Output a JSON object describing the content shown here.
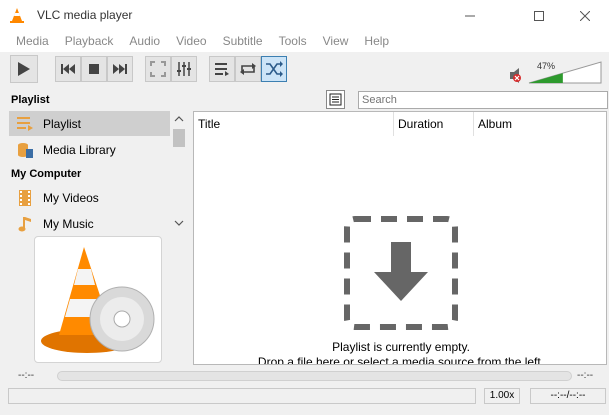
{
  "window": {
    "title": "VLC media player"
  },
  "menu": [
    "Media",
    "Playback",
    "Audio",
    "Video",
    "Subtitle",
    "Tools",
    "View",
    "Help"
  ],
  "toolbar": {
    "buttons": [
      {
        "name": "play-icon"
      },
      {
        "name": "previous-icon"
      },
      {
        "name": "stop-icon"
      },
      {
        "name": "next-icon"
      },
      {
        "name": "fullscreen-icon"
      },
      {
        "name": "extended-settings-icon"
      },
      {
        "name": "playlist-toggle-icon"
      },
      {
        "name": "loop-icon"
      },
      {
        "name": "random-icon"
      }
    ],
    "volume_percent": "47%",
    "volume_level": 0.47
  },
  "sidebar": {
    "playlist_header": "Playlist",
    "playlist_items": [
      "Playlist",
      "Media Library"
    ],
    "computer_header": "My Computer",
    "computer_items": [
      "My Videos",
      "My Music"
    ]
  },
  "search": {
    "placeholder": "Search"
  },
  "playlist": {
    "columns": [
      "Title",
      "Duration",
      "Album"
    ],
    "empty_line1": "Playlist is currently empty.",
    "empty_line2": "Drop a file here or select a media source from the left."
  },
  "seek": {
    "elapsed": "--:--",
    "remaining": "--:--"
  },
  "status": {
    "speed": "1.00x",
    "time": "--:--/--:--"
  },
  "colors": {
    "accent": "#ff8800",
    "active_button": "#cce4f7",
    "volume_fill": "#2d9a2d"
  }
}
